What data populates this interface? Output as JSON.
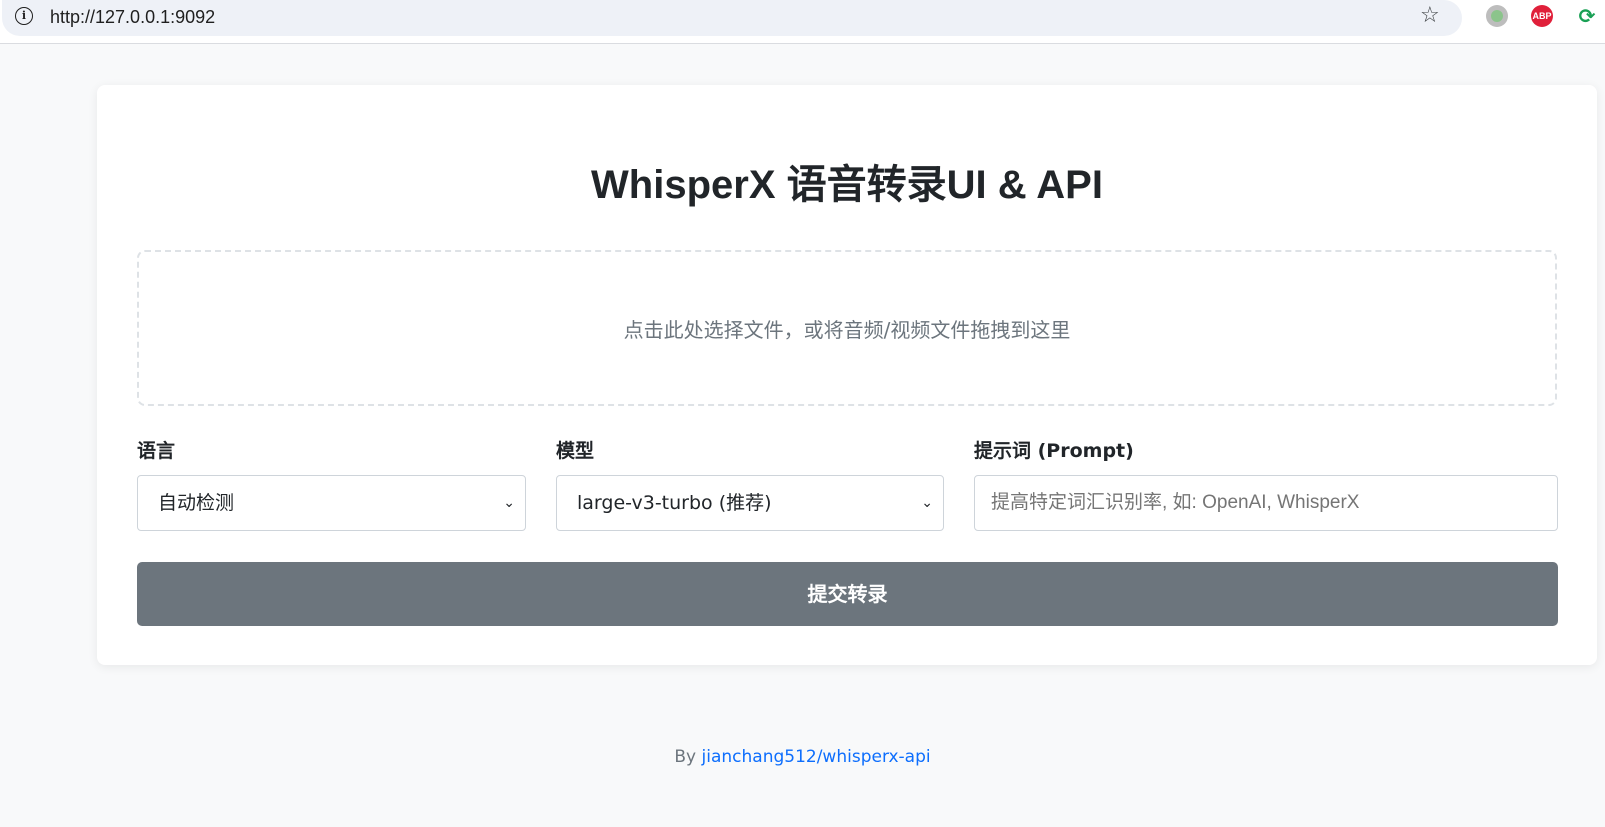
{
  "browser": {
    "url": "http://127.0.0.1:9092",
    "icons": [
      "info-icon",
      "star-icon",
      "extension-icon",
      "adblock-plus-icon",
      "sync-icon"
    ],
    "abp_label": "ABP"
  },
  "main": {
    "title": "WhisperX 语音转录UI & API",
    "dropzone_text": "点击此处选择文件，或将音频/视频文件拖拽到这里",
    "language": {
      "label": "语言",
      "selected": "自动检测"
    },
    "model": {
      "label": "模型",
      "selected": "large-v3-turbo (推荐)"
    },
    "prompt": {
      "label": "提示词 (Prompt)",
      "placeholder": "提高特定词汇识别率, 如: OpenAI, WhisperX"
    },
    "submit_label": "提交转录"
  },
  "footer": {
    "prefix": "By",
    "link_text": "jianchang512/whisperx-api"
  },
  "colors": {
    "page_bg": "#f8f9fa",
    "card_bg": "#ffffff",
    "button_bg": "#6c757d",
    "link": "#0d6efd"
  }
}
